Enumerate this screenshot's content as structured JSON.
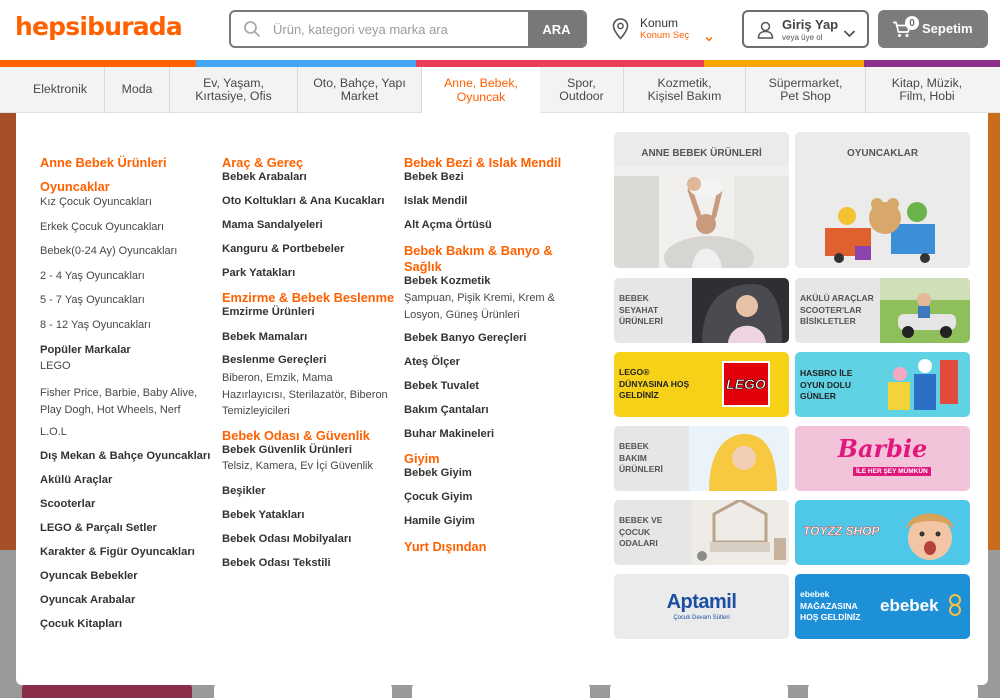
{
  "header": {
    "logo": "hepsiburada",
    "search_placeholder": "Ürün, kategori veya marka ara",
    "search_button": "ARA",
    "location_title": "Konum",
    "location_action": "Konum Seç",
    "login_title": "Giriş Yap",
    "login_sub": "veya üye ol",
    "cart_label": "Sepetim",
    "cart_count": "0"
  },
  "stripe_colors": [
    "#ff6000",
    "#42a5f5",
    "#e83e5a",
    "#f7a600",
    "#8b2f8a"
  ],
  "nav": {
    "active_color": "#ff6000",
    "items": [
      {
        "label": "Elektronik"
      },
      {
        "label": "Moda"
      },
      {
        "label": "Ev, Yaşam,\nKırtasiye, Ofis"
      },
      {
        "label": "Oto, Bahçe, Yapı\nMarket"
      },
      {
        "label": "Anne, Bebek,\nOyuncak"
      },
      {
        "label": "Spor,\nOutdoor"
      },
      {
        "label": "Kozmetik,\nKişisel Bakım"
      },
      {
        "label": "Süpermarket,\nPet Shop"
      },
      {
        "label": "Kitap, Müzik,\nFilm, Hobi"
      }
    ]
  },
  "menu": {
    "col1": [
      {
        "t": "Anne Bebek Ürünleri",
        "s": "h"
      },
      {
        "t": "Oyuncaklar",
        "s": "h"
      },
      {
        "t": "Kız Çocuk Oyuncakları",
        "s": "n"
      },
      {
        "t": "Erkek Çocuk Oyuncakları",
        "s": "n"
      },
      {
        "t": "Bebek(0-24 Ay) Oyuncakları",
        "s": "n"
      },
      {
        "t": "2 - 4 Yaş Oyuncakları",
        "s": "n"
      },
      {
        "t": "5 - 7 Yaş Oyuncakları",
        "s": "n"
      },
      {
        "t": "8 - 12 Yaş Oyuncakları",
        "s": "n"
      },
      {
        "t": "Popüler Markalar",
        "s": "b"
      },
      {
        "t": "LEGO",
        "s": "n"
      },
      {
        "t": "Fisher Price,  Barbie,  Baby Alive,  Play Dogh,  Hot Wheels,  Nerf",
        "s": "n"
      },
      {
        "t": "L.O.L",
        "s": "n"
      },
      {
        "t": "Dış Mekan & Bahçe Oyuncakları",
        "s": "b"
      },
      {
        "t": "Akülü Araçlar",
        "s": "b"
      },
      {
        "t": "Scooterlar",
        "s": "b"
      },
      {
        "t": "LEGO & Parçalı Setler",
        "s": "b"
      },
      {
        "t": "Karakter & Figür Oyuncakları",
        "s": "b"
      },
      {
        "t": "Oyuncak Bebekler",
        "s": "b"
      },
      {
        "t": "Oyuncak Arabalar",
        "s": "b"
      },
      {
        "t": "Çocuk Kitapları",
        "s": "b"
      }
    ],
    "col2": [
      {
        "t": "Araç & Gereç",
        "s": "h"
      },
      {
        "t": "Bebek Arabaları",
        "s": "b"
      },
      {
        "t": "Oto Koltukları & Ana Kucakları",
        "s": "b"
      },
      {
        "t": "Mama Sandalyeleri",
        "s": "b"
      },
      {
        "t": "Kanguru & Portbebeler",
        "s": "b"
      },
      {
        "t": "Park Yatakları",
        "s": "b"
      },
      {
        "t": "Emzirme & Bebek Beslenme",
        "s": "h"
      },
      {
        "t": "Emzirme Ürünleri",
        "s": "b"
      },
      {
        "t": "Bebek Mamaları",
        "s": "b"
      },
      {
        "t": "Beslenme Gereçleri",
        "s": "b"
      },
      {
        "t": "Biberon,  Emzik,  Mama Hazırlayıcısı,  Sterilazatör,  Biberon Temizleyicileri",
        "s": "n"
      },
      {
        "t": "Bebek Odası & Güvenlik",
        "s": "h"
      },
      {
        "t": "Bebek Güvenlik Ürünleri",
        "s": "b"
      },
      {
        "t": "Telsiz,  Kamera,  Ev İçi Güvenlik",
        "s": "n"
      },
      {
        "t": "Beşikler",
        "s": "b"
      },
      {
        "t": "Bebek Yatakları",
        "s": "b"
      },
      {
        "t": "Bebek Odası Mobilyaları",
        "s": "b"
      },
      {
        "t": "Bebek Odası Tekstili",
        "s": "b"
      }
    ],
    "col3": [
      {
        "t": "Bebek Bezi & Islak Mendil",
        "s": "h"
      },
      {
        "t": "Bebek Bezi",
        "s": "b"
      },
      {
        "t": "Islak Mendil",
        "s": "b"
      },
      {
        "t": "Alt Açma Örtüsü",
        "s": "b"
      },
      {
        "t": "Bebek Bakım & Banyo & Sağlık",
        "s": "h"
      },
      {
        "t": "Bebek Kozmetik",
        "s": "b"
      },
      {
        "t": "Şampuan,  Pişik Kremi,  Krem &  Losyon,  Güneş Ürünleri",
        "s": "n"
      },
      {
        "t": "Bebek Banyo Gereçleri",
        "s": "b"
      },
      {
        "t": "Ateş Ölçer",
        "s": "b"
      },
      {
        "t": "Bebek Tuvalet",
        "s": "b"
      },
      {
        "t": "Bakım Çantaları",
        "s": "b"
      },
      {
        "t": "Buhar Makineleri",
        "s": "b"
      },
      {
        "t": "Giyim",
        "s": "h"
      },
      {
        "t": "Bebek Giyim",
        "s": "b"
      },
      {
        "t": "Çocuk Giyim",
        "s": "b"
      },
      {
        "t": "Hamile Giyim",
        "s": "b"
      },
      {
        "t": "Yurt Dışından",
        "s": "h"
      }
    ]
  },
  "tiles": [
    {
      "title": "ANNE BEBEK ÜRÜNLERİ",
      "color": "#ebebeb"
    },
    {
      "title": "OYUNCAKLAR",
      "color": "#ebebeb"
    },
    {
      "title": "BEBEK SEYAHAT ÜRÜNLERİ",
      "color": "#e6e6e6"
    },
    {
      "title": "AKÜLÜ ARAÇLAR SCOOTER'LAR BİSİKLETLER",
      "color": "#e6e6e6"
    },
    {
      "title": "LEGO® DÜNYASINA HOŞ GELDİNİZ",
      "color": "#f7d117",
      "brand": "LEGO"
    },
    {
      "title": "HASBRO İLE OYUN DOLU GÜNLER",
      "color": "#5fd3e3"
    },
    {
      "title": "BEBEK BAKIM ÜRÜNLERİ",
      "color": "#e6e6e6"
    },
    {
      "title": "",
      "color": "#f3c3d9",
      "brand": "Barbie",
      "tagline": "İLE HER ŞEY MÜMKÜN"
    },
    {
      "title": "BEBEK VE ÇOCUK ODALARI",
      "color": "#e6e6e6"
    },
    {
      "title": "",
      "color": "#4fc7e8",
      "brand": "TOYZZ SHOP"
    },
    {
      "title": "",
      "color": "#ebebeb",
      "brand": "Aptamil",
      "tagline": "Çocuk Devam Sütleri"
    },
    {
      "title": "ebebek MAĞAZASINA HOŞ GELDİNİZ",
      "color": "#1e90d8",
      "brand": "ebebek"
    }
  ]
}
